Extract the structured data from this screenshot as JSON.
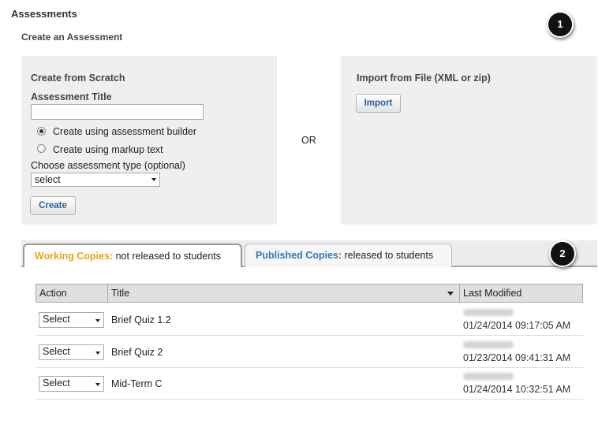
{
  "page": {
    "heading": "Assessments",
    "subheading": "Create an Assessment"
  },
  "create_panel": {
    "title": "Create from Scratch",
    "assessment_title_label": "Assessment Title",
    "assessment_title_value": "",
    "radio_options": [
      {
        "label": "Create using assessment builder",
        "checked": true
      },
      {
        "label": "Create using markup text",
        "checked": false
      }
    ],
    "type_label": "Choose assessment type (optional)",
    "type_selected": "select",
    "create_button": "Create"
  },
  "or_label": "OR",
  "import_panel": {
    "title": "Import from File (XML or zip)",
    "import_button": "Import"
  },
  "callouts": [
    "1",
    "2"
  ],
  "tabs": [
    {
      "accent": "Working Copies:",
      "rest": " not released to students",
      "active": true,
      "accent_color": "#e8a317"
    },
    {
      "accent": "Published Copies:",
      "rest": " released to students",
      "active": false,
      "accent_color": "#2f7ab9"
    }
  ],
  "table": {
    "columns": [
      "Action",
      "Title",
      "Last Modified"
    ],
    "rows": [
      {
        "action": "Select",
        "title": "Brief Quiz 1.2",
        "modified": "01/24/2014 09:17:05 AM"
      },
      {
        "action": "Select",
        "title": "Brief Quiz 2",
        "modified": "01/23/2014 09:41:31 AM"
      },
      {
        "action": "Select",
        "title": "Mid-Term C",
        "modified": "01/24/2014 10:32:51 AM"
      }
    ]
  }
}
